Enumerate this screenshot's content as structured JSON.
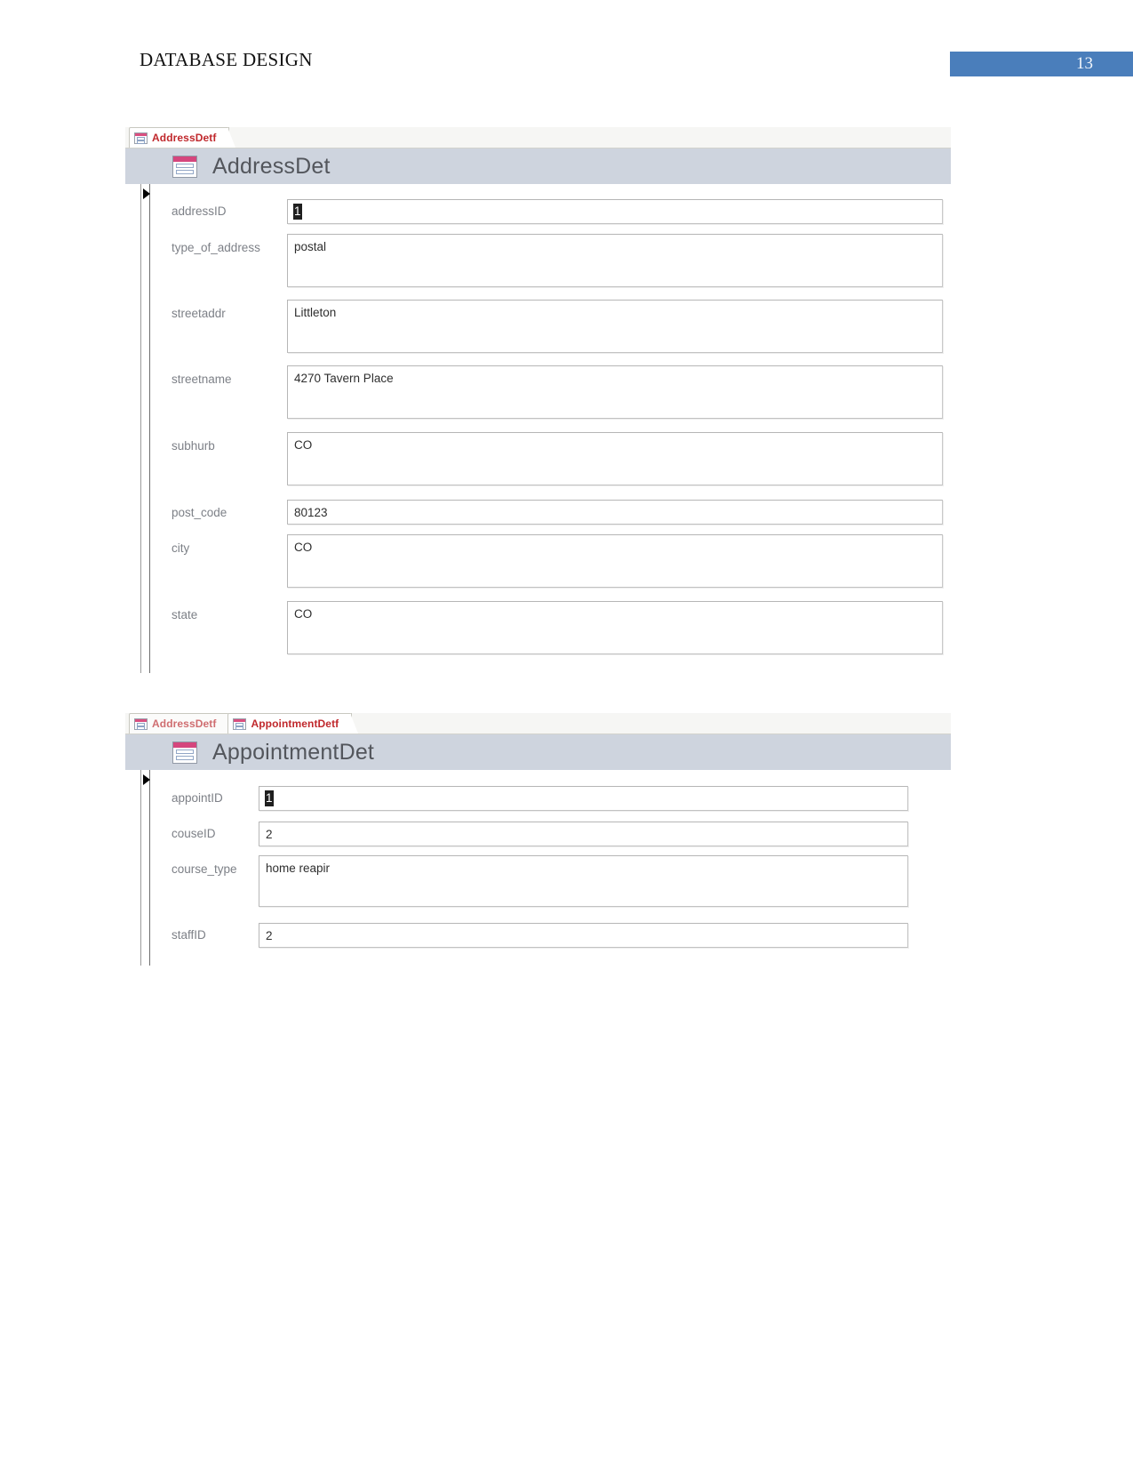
{
  "document": {
    "header_title": "DATABASE DESIGN",
    "page_number": "13",
    "accent_color": "#4a7ebb"
  },
  "forms": [
    {
      "tabs": [
        {
          "label": "AddressDetf",
          "active": true
        }
      ],
      "title": "AddressDet",
      "fields": [
        {
          "label": "addressID",
          "value": "1",
          "selected": true,
          "multiline": false
        },
        {
          "label": "type_of_address",
          "value": "postal",
          "selected": false,
          "multiline": true
        },
        {
          "label": "streetaddr",
          "value": "Littleton",
          "selected": false,
          "multiline": true
        },
        {
          "label": "streetname",
          "value": "4270 Tavern Place",
          "selected": false,
          "multiline": true
        },
        {
          "label": "subhurb",
          "value": "CO",
          "selected": false,
          "multiline": true
        },
        {
          "label": "post_code",
          "value": "80123",
          "selected": false,
          "multiline": false
        },
        {
          "label": "city",
          "value": "CO",
          "selected": false,
          "multiline": true
        },
        {
          "label": "state",
          "value": "CO",
          "selected": false,
          "multiline": true
        }
      ]
    },
    {
      "tabs": [
        {
          "label": "AddressDetf",
          "active": false
        },
        {
          "label": "AppointmentDetf",
          "active": true
        }
      ],
      "title": "AppointmentDet",
      "fields": [
        {
          "label": "appointID",
          "value": "1",
          "selected": true,
          "multiline": false
        },
        {
          "label": "couseID",
          "value": "2",
          "selected": false,
          "multiline": false
        },
        {
          "label": "course_type",
          "value": "home reapir",
          "selected": false,
          "multiline": true
        },
        {
          "label": "staffID",
          "value": "2",
          "selected": false,
          "multiline": false
        }
      ]
    }
  ]
}
